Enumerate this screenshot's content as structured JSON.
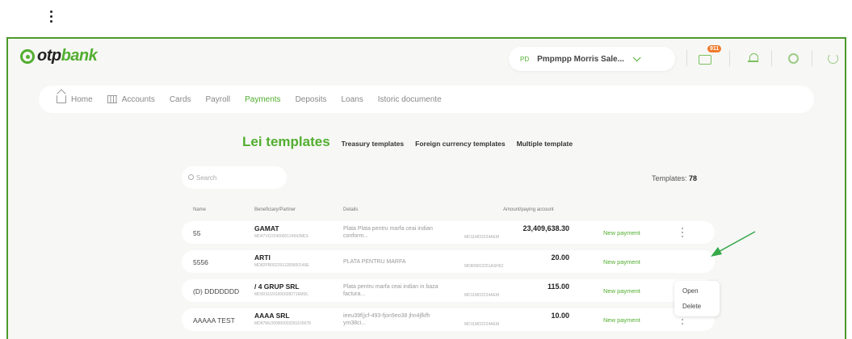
{
  "header": {
    "logo_prefix": "otp",
    "logo_suffix": "bank",
    "profile_initials": "PD",
    "profile_name": "Pmpmpp Morris Sale...",
    "mail_badge": "911",
    "colors": {
      "brand": "#52ae30",
      "badge": "#f07a2a",
      "frame": "#4c9a2a"
    }
  },
  "nav": {
    "items": [
      {
        "label": "Home",
        "icon": "home-icon"
      },
      {
        "label": "Accounts",
        "icon": "bank-icon"
      },
      {
        "label": "Cards"
      },
      {
        "label": "Payroll"
      },
      {
        "label": "Payments",
        "active": true
      },
      {
        "label": "Deposits"
      },
      {
        "label": "Loans"
      },
      {
        "label": "Istoric documente"
      }
    ]
  },
  "templates": {
    "tabs": {
      "lei": "Lei templates",
      "treasury": "Treasury templates",
      "foreign": "Foreign currency templates",
      "multiple": "Multiple template"
    },
    "search_placeholder": "Search",
    "count_label": "Templates:",
    "count_value": "78",
    "columns": {
      "name": "Name",
      "beneficiary": "Beneficiary/Partner",
      "details": "Details",
      "amount": "Amount/paying account"
    },
    "rows": [
      {
        "name": "55",
        "beneficiary": "GAMAT",
        "beneficiary_account": "MD47VI22240000124542MDL",
        "details": "Plata Plata pentru marfa ceai indian conform...",
        "amount": "23,409,638.30",
        "paying_account": "MD11MO2224AEM",
        "action": "New payment"
      },
      {
        "name": "5556",
        "beneficiary": "ARTI",
        "beneficiary_account": "MD82PR0022911289500149E",
        "details": "PLATA PENTRU MARFA",
        "amount": "20.00",
        "paying_account": "MD80MO2251ASH62",
        "action": "New payment"
      },
      {
        "name": "(D) DDDDDDD",
        "beneficiary": "/      4 GRUP SRL",
        "beneficiary_account": "MD00SU2910000282716MDL",
        "details": "Plata pentru marfa ceai indian in baza factura...",
        "amount": "115.00",
        "paying_account": "MD11MO2224AEM",
        "action": "New payment"
      },
      {
        "name": "AAAAA TEST",
        "beneficiary": "AAAA SRL",
        "beneficiary_account": "MD87ML000000003281106678",
        "details": "ieeu39f(jcf-493-fjon9eo38 jhn4jfkfh ym38ci...",
        "amount": "10.00",
        "paying_account": "MD11MO2224AEM",
        "action": "New payment"
      }
    ]
  },
  "context_menu": {
    "open": "Open",
    "delete": "Delete"
  }
}
